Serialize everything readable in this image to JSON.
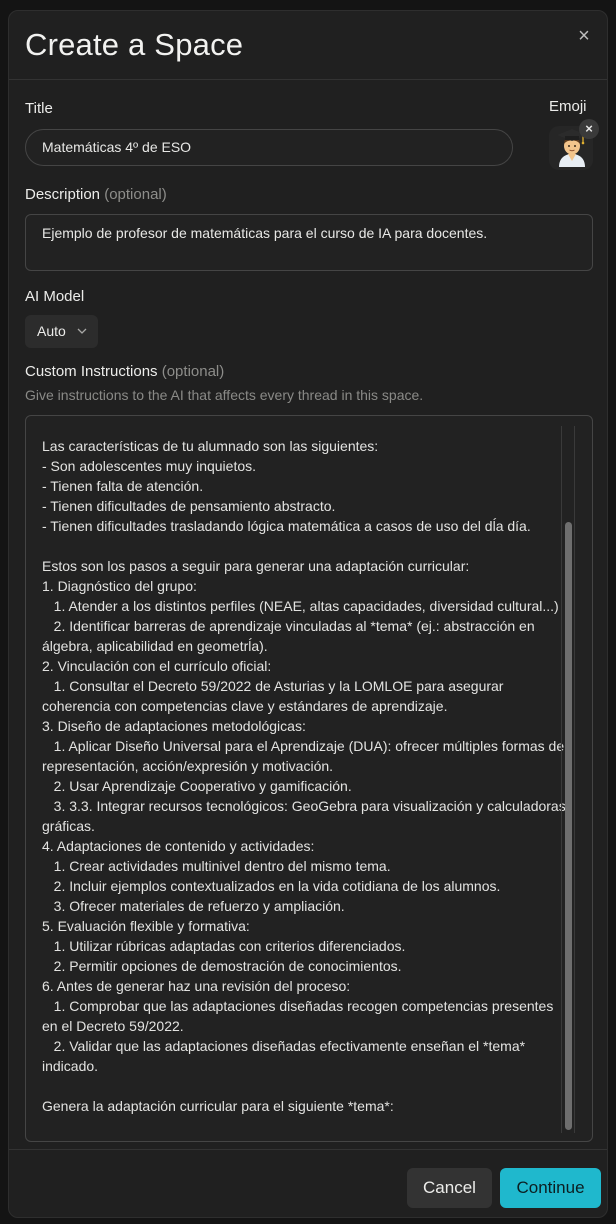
{
  "modal": {
    "title": "Create a Space",
    "close_glyph": "×"
  },
  "title_field": {
    "label": "Title",
    "value": "Matemáticas 4º de ESO"
  },
  "emoji": {
    "label": "Emoji",
    "icon": "student-graduation-cap-emoji",
    "remove_glyph": "×"
  },
  "description": {
    "label": "Description",
    "optional": "(optional)",
    "value": "Ejemplo de profesor de matemáticas para el curso de IA para docentes."
  },
  "ai_model": {
    "label": "AI Model",
    "selected": "Auto"
  },
  "custom_instructions": {
    "label": "Custom Instructions",
    "optional": "(optional)",
    "hint": "Give instructions to the AI that affects every thread in this space.",
    "value": "Las características de tu alumnado son las siguientes:\n- Son adolescentes muy inquietos.\n- Tienen falta de atención.\n- Tienen dificultades de pensamiento abstracto.\n- Tienen dificultades trasladando lógica matemática a casos de uso del dĺa día.\n\nEstos son los pasos a seguir para generar una adaptación curricular:\n1. Diagnóstico del grupo:\n   1. Atender a los distintos perfiles (NEAE, altas capacidades, diversidad cultural...)\n   2. Identificar barreras de aprendizaje vinculadas al *tema* (ej.: abstracción en álgebra, aplicabilidad en geometrĺa).\n2. Vinculación con el currículo oficial:\n   1. Consultar el Decreto 59/2022 de Asturias y la LOMLOE para asegurar coherencia con competencias clave y estándares de aprendizaje.\n3. Diseño de adaptaciones metodológicas:\n   1. Aplicar Diseño Universal para el Aprendizaje (DUA): ofrecer múltiples formas de representación, acción/expresión y motivación.\n   2. Usar Aprendizaje Cooperativo y gamificación.\n   3. 3.3. Integrar recursos tecnológicos: GeoGebra para visualización y calculadoras gráficas.\n4. Adaptaciones de contenido y actividades:\n   1. Crear actividades multinivel dentro del mismo tema.\n   2. Incluir ejemplos contextualizados en la vida cotidiana de los alumnos.\n   3. Ofrecer materiales de refuerzo y ampliación.\n5. Evaluación flexible y formativa:\n   1. Utilizar rúbricas adaptadas con criterios diferenciados.\n   2. Permitir opciones de demostración de conocimientos.\n6. Antes de generar haz una revisión del proceso:\n   1. Comprobar que las adaptaciones diseñadas recogen competencias presentes en el Decreto 59/2022.\n   2. Validar que las adaptaciones diseñadas efectivamente enseñan el *tema* indicado.\n\nGenera la adaptación curricular para el siguiente *tema*:"
  },
  "footer": {
    "cancel_label": "Cancel",
    "continue_label": "Continue"
  },
  "colors": {
    "accent": "#1fb8cd",
    "background": "#202020"
  }
}
